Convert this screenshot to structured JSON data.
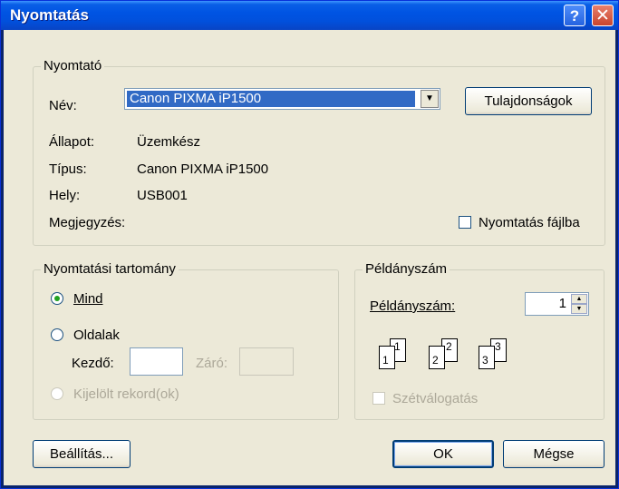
{
  "window": {
    "title": "Nyomtatás",
    "help_icon": "?",
    "close_icon": "✕"
  },
  "printer": {
    "legend": "Nyomtató",
    "name_label": "Név:",
    "name_value": "Canon PIXMA iP1500",
    "properties_label": "Tulajdonságok",
    "status_label": "Állapot:",
    "status_value": "Üzemkész",
    "type_label": "Típus:",
    "type_value": "Canon PIXMA iP1500",
    "where_label": "Hely:",
    "where_value": "USB001",
    "comment_label": "Megjegyzés:",
    "print_to_file_label": "Nyomtatás fájlba"
  },
  "range": {
    "legend": "Nyomtatási tartomány",
    "all_label": "Mind",
    "pages_label": "Oldalak",
    "from_label": "Kezdő:",
    "to_label": "Záró:",
    "selected_label": "Kijelölt rekord(ok)"
  },
  "copies": {
    "legend": "Példányszám",
    "count_label": "Példányszám:",
    "count_value": "1",
    "collate_label": "Szétválogatás",
    "page_numbers": [
      "1",
      "1",
      "2",
      "2",
      "3",
      "3"
    ]
  },
  "footer": {
    "setup_label": "Beállítás...",
    "ok_label": "OK",
    "cancel_label": "Mégse"
  }
}
